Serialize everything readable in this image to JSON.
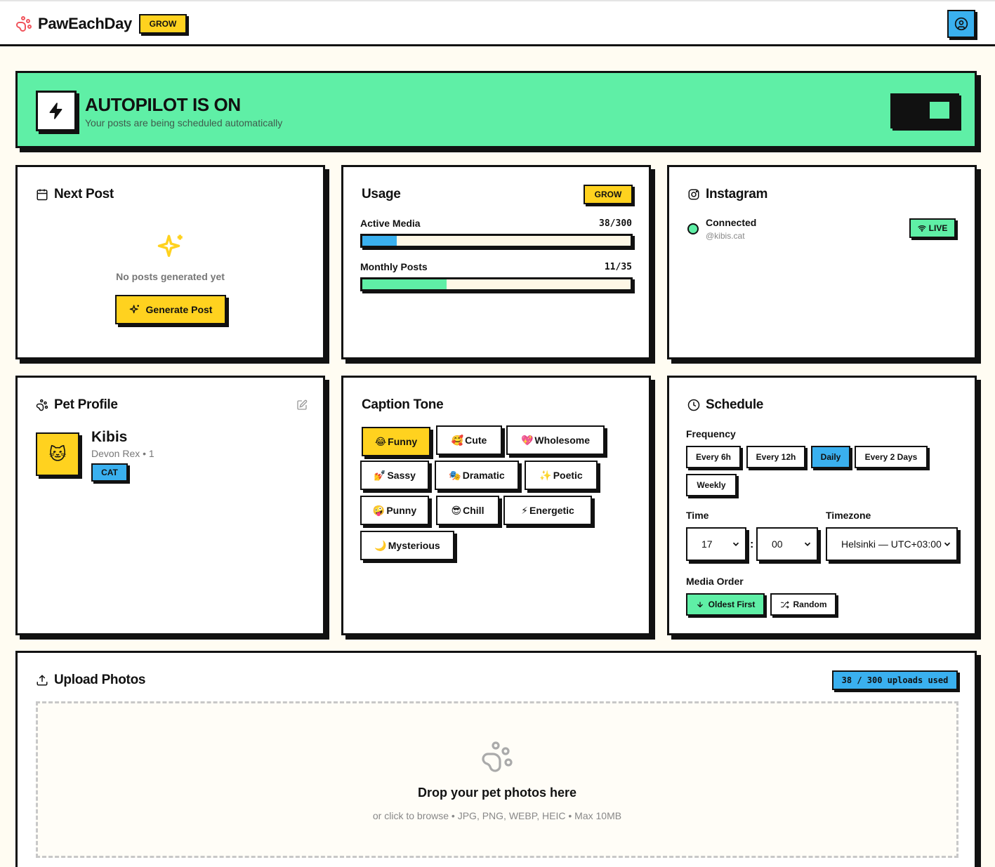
{
  "header": {
    "brand": "PawEachDay",
    "plan_badge": "GROW"
  },
  "autopilot": {
    "title": "AUTOPILOT IS ON",
    "subtitle": "Your posts are being scheduled automatically",
    "enabled": true
  },
  "next_post": {
    "title": "Next Post",
    "empty_text": "No posts generated yet",
    "generate_label": "Generate Post"
  },
  "usage": {
    "title": "Usage",
    "plan_badge": "GROW",
    "meters": [
      {
        "label": "Active Media",
        "count": "38/300",
        "fraction": 0.127,
        "color": "#3ab0ef"
      },
      {
        "label": "Monthly Posts",
        "count": "11/35",
        "fraction": 0.314,
        "color": "#5fefa6"
      }
    ]
  },
  "instagram": {
    "title": "Instagram",
    "status": "Connected",
    "handle": "@kibis.cat",
    "live_label": "LIVE"
  },
  "pet_profile": {
    "title": "Pet Profile",
    "avatar_emoji": "🐱",
    "name": "Kibis",
    "breed_age": "Devon Rex • 1",
    "species_tag": "CAT"
  },
  "caption_tone": {
    "title": "Caption Tone",
    "selected": "Funny",
    "options": [
      {
        "emoji": "😂",
        "label": "Funny"
      },
      {
        "emoji": "🥰",
        "label": "Cute"
      },
      {
        "emoji": "💖",
        "label": "Wholesome"
      },
      {
        "emoji": "💅",
        "label": "Sassy"
      },
      {
        "emoji": "🎭",
        "label": "Dramatic"
      },
      {
        "emoji": "✨",
        "label": "Poetic"
      },
      {
        "emoji": "🤪",
        "label": "Punny"
      },
      {
        "emoji": "😎",
        "label": "Chill"
      },
      {
        "emoji": "⚡",
        "label": "Energetic"
      },
      {
        "emoji": "🌙",
        "label": "Mysterious"
      }
    ]
  },
  "schedule": {
    "title": "Schedule",
    "frequency_label": "Frequency",
    "frequency_options": [
      "Every 6h",
      "Every 12h",
      "Daily",
      "Every 2 Days",
      "Weekly"
    ],
    "frequency_selected": "Daily",
    "time_label": "Time",
    "hour": "17",
    "minute": "00",
    "timezone_label": "Timezone",
    "timezone": "Helsinki — UTC+03:00",
    "media_order_label": "Media Order",
    "order_oldest": "Oldest First",
    "order_random": "Random",
    "order_selected": "Oldest First"
  },
  "upload": {
    "title": "Upload Photos",
    "usage_badge": "38 / 300 uploads used",
    "drop_title": "Drop your pet photos here",
    "drop_subtitle": "or click to browse • JPG, PNG, WEBP, HEIC • Max 10MB"
  },
  "colors": {
    "yellow": "#ffd21f",
    "green": "#5fefa6",
    "blue": "#3ab0ef",
    "ink": "#111111",
    "background": "#fffcf2",
    "logo_red": "#f0545c"
  }
}
